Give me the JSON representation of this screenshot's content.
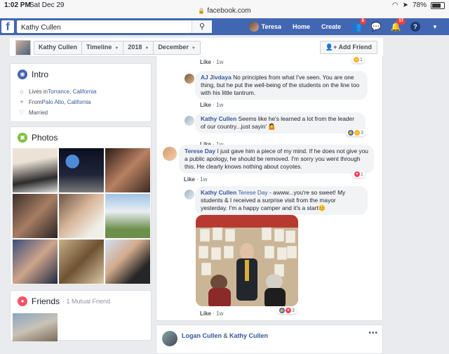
{
  "statusbar": {
    "time": "1:02 PM",
    "date": "Sat Dec 29",
    "url": "facebook.com",
    "battery": "78%"
  },
  "nav": {
    "logo": "f",
    "search_value": "Kathy Cullen",
    "user_name": "Teresa",
    "home": "Home",
    "create": "Create",
    "friend_badge": "5",
    "notif_badge": "17",
    "help": "?"
  },
  "timeline": {
    "crumbs": [
      "Kathy Cullen",
      "Timeline",
      "2018",
      "December"
    ],
    "add_friend": "Add Friend"
  },
  "intro": {
    "title": "Intro",
    "lives_prefix": "Lives in ",
    "lives_city": "Torrance, California",
    "from_prefix": "From ",
    "from_city": "Palo Alto, California",
    "relationship": "Married"
  },
  "photos": {
    "title": "Photos"
  },
  "friends": {
    "title": "Friends",
    "subtitle": "· 1 Mutual Friend"
  },
  "feed": {
    "like": "Like",
    "comments": [
      {
        "name": "AJ Jivdaya",
        "text": "No principles from what I've seen. You are one thing, but he put the well-being of the students on the line too with his little tantrum.",
        "time": "1w"
      },
      {
        "name": "Kathy Cullen",
        "text": "Seems like he's learned a lot from the leader of our country...just sayin' 🤷",
        "time": "1w",
        "reactions": "3"
      },
      {
        "name": "Terese Day",
        "text": "I just gave him a piece of my mind. If he does not give you a public apology, he should be removed. I'm sorry you went through this. He clearly knows nothing about coyotes.",
        "time": "1w",
        "reactions": "1"
      },
      {
        "name": "Kathy Cullen",
        "mention": "Terese Day",
        "text": "- awww...you're so sweet! My students & I received a surprise visit from the mayor yesterday. I'm a happy camper and it's a start😊",
        "time": "1w",
        "reactions": "3"
      }
    ],
    "top_reaction_count": "1",
    "top_time": "1w"
  },
  "feed2": {
    "name1": "Logan Cullen",
    "amp": " & ",
    "name2": "Kathy Cullen"
  },
  "colors": {
    "fb_blue": "#4267b2",
    "link": "#365899",
    "bg": "#e9ebee"
  }
}
